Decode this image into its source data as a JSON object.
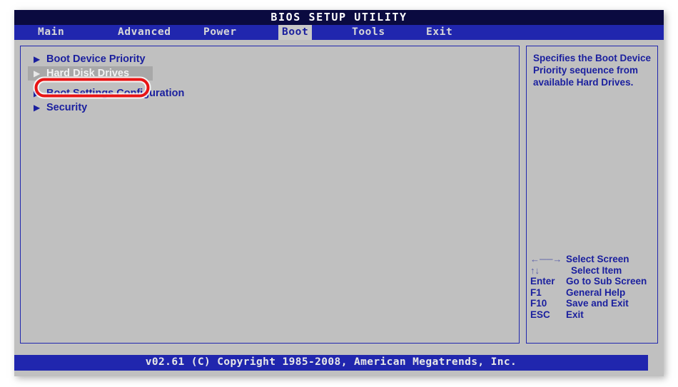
{
  "window": {
    "title": "BIOS SETUP UTILITY"
  },
  "menubar": {
    "tabs": [
      {
        "label": "Main",
        "active": false
      },
      {
        "label": "Advanced",
        "active": false
      },
      {
        "label": "Power",
        "active": false
      },
      {
        "label": "Boot",
        "active": true
      },
      {
        "label": "Tools",
        "active": false
      },
      {
        "label": "Exit",
        "active": false
      }
    ]
  },
  "main": {
    "items": [
      {
        "label": "Boot Device Priority",
        "selected": false
      },
      {
        "label": "Hard Disk Drives",
        "selected": true
      },
      {
        "label": "Boot Settings Configuration",
        "selected": false
      },
      {
        "label": "Security",
        "selected": false
      }
    ]
  },
  "help": {
    "text": "Specifies the Boot Device Priority sequence from available Hard Drives."
  },
  "legend": {
    "rows": [
      {
        "key": "←──→",
        "desc": "Select Screen",
        "glyph": true,
        "indent": false
      },
      {
        "key": "↑↓",
        "desc": "Select Item",
        "glyph": true,
        "indent": true
      },
      {
        "key": "Enter",
        "desc": "Go to Sub Screen",
        "glyph": false,
        "indent": false
      },
      {
        "key": "F1",
        "desc": "General Help",
        "glyph": false,
        "indent": false
      },
      {
        "key": "F10",
        "desc": "Save and Exit",
        "glyph": false,
        "indent": false
      },
      {
        "key": "ESC",
        "desc": "Exit",
        "glyph": false,
        "indent": false
      }
    ]
  },
  "footer": {
    "text": "v02.61 (C) Copyright 1985-2008, American Megatrends, Inc."
  },
  "annotation": {
    "shape": "red-oval-highlight",
    "target": "Hard Disk Drives",
    "stroke_color": "#e81414",
    "halo_color": "#ffffff"
  },
  "colors": {
    "titlebar": "#0a0a40",
    "menubar": "#2026ae",
    "panel_bg": "#c0c0c0",
    "panel_border": "#2026ae",
    "text_blue": "#1a1f9e",
    "selected_row_bg": "#a8a8a8",
    "selected_row_text": "#f2f2f2",
    "footer_bg": "#2026ae"
  }
}
